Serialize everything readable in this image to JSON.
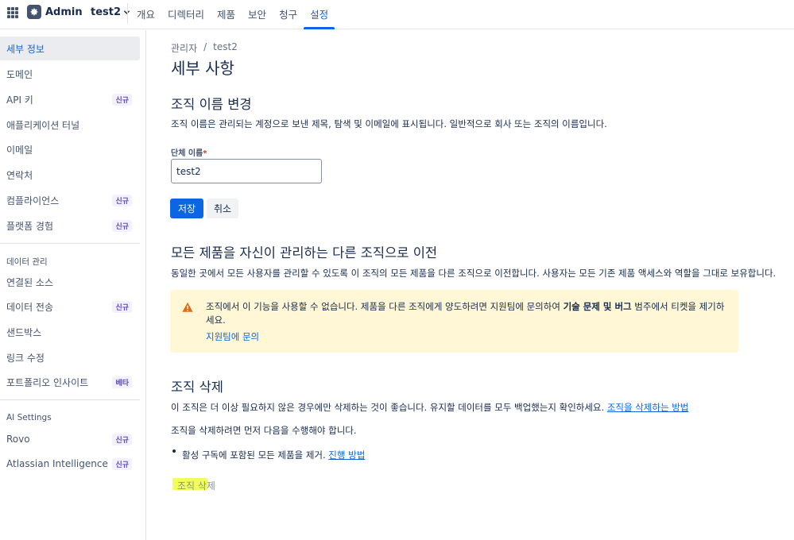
{
  "topbar": {
    "app_name": "Admin",
    "org": "test2",
    "tabs": [
      "개요",
      "디렉터리",
      "제품",
      "보안",
      "청구",
      "설정"
    ]
  },
  "sidebar": {
    "items": [
      {
        "label": "세부 정보"
      },
      {
        "label": "도메인"
      },
      {
        "label": "API 키",
        "badge": "신규"
      },
      {
        "label": "애플리케이션 터널"
      },
      {
        "label": "이메일"
      },
      {
        "label": "연락처"
      },
      {
        "label": "컴플라이언스",
        "badge": "신규"
      },
      {
        "label": "플랫폼 경험",
        "badge": "신규"
      }
    ],
    "data_heading": "데이터 관리",
    "data_items": [
      {
        "label": "연결된 소스"
      },
      {
        "label": "데이터 전송",
        "badge": "신규"
      },
      {
        "label": "샌드박스"
      },
      {
        "label": "링크 수정"
      },
      {
        "label": "포트폴리오 인사이트",
        "badge": "베타"
      }
    ],
    "ai_heading": "AI Settings",
    "ai_items": [
      {
        "label": "Rovo",
        "badge": "신규"
      },
      {
        "label": "Atlassian Intelligence",
        "badge": "신규"
      }
    ]
  },
  "main": {
    "breadcrumb": [
      "관리자",
      "test2"
    ],
    "breadcrumb_sep": "/",
    "title": "세부 사항",
    "rename": {
      "heading": "조직 이름 변경",
      "desc": "조직 이름은 관리되는 계정으로 보낸 제목, 탐색 및 이메일에 표시됩니다. 일반적으로 회사 또는 조직의 이름입니다.",
      "field_label": "단체 이름",
      "required_mark": "*",
      "value": "test2",
      "save": "저장",
      "cancel": "취소"
    },
    "transfer": {
      "heading": "모든 제품을 자신이 관리하는 다른 조직으로 이전",
      "desc": "동일한 곳에서 모든 사용자를 관리할 수 있도록 이 조직의 모든 제품을 다른 조직으로 이전합니다. 사용자는 모든 기존 제품 액세스와 역할을 그대로 보유합니다.",
      "warning_pre": "조직에서 이 기능을 사용할 수 없습니다. 제품을 다른 조직에게 양도하려면 지원팀에 문의하여 ",
      "warning_bold": "기술 문제 및 버그",
      "warning_post": " 범주에서 티켓을 제기하세요.",
      "warning_link": "지원팀에 문의"
    },
    "delete": {
      "heading": "조직 삭제",
      "desc": "이 조직은 더 이상 필요하지 않은 경우에만 삭제하는 것이 좋습니다. 유지할 데이터를 모두 백업했는지 확인하세요.",
      "desc_link": "조직을 삭제하는 방법",
      "prereq": "조직을 삭제하려면 먼저 다음을 수행해야 합니다.",
      "bullet": "활성 구독에 포함된 모든 제품을 제거.",
      "bullet_link": "진행 방법",
      "button": "조직 삭제"
    }
  },
  "colors": {
    "accent": "#0c66e4",
    "warning_bg": "#fff7d6",
    "warning_icon": "#e56910",
    "highlight": "#f0ff3a"
  }
}
